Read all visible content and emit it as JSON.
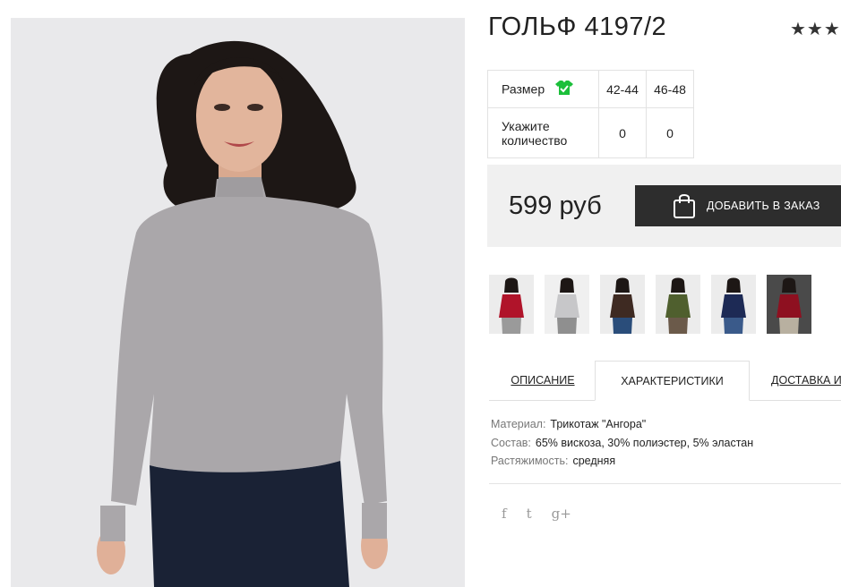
{
  "product": {
    "title": "ГОЛЬФ 4197/2",
    "rating_stars": "★★★",
    "rating": 3
  },
  "size_table": {
    "size_label": "Размер",
    "sizes": [
      "42-44",
      "46-48"
    ],
    "quantity_label": "Укажите количество",
    "quantities": [
      "0",
      "0"
    ]
  },
  "purchase": {
    "price": "599 руб",
    "add_button_label": "ДОБАВИТЬ В ЗАКАЗ"
  },
  "thumbnails": [
    {
      "top": "#b0142a",
      "bottom": "#9a9a9a",
      "bg": "#ececec"
    },
    {
      "top": "#c7c7c9",
      "bottom": "#8f8f8f",
      "bg": "#f0f0f0"
    },
    {
      "top": "#3e2a22",
      "bottom": "#2a4d7a",
      "bg": "#ececec"
    },
    {
      "top": "#4f5f2e",
      "bottom": "#6b5a4a",
      "bg": "#ececec"
    },
    {
      "top": "#1d2a55",
      "bottom": "#3a5a8a",
      "bg": "#ececec"
    },
    {
      "top": "#8e1020",
      "bottom": "#b8b0a0",
      "bg": "#4a4a4a"
    }
  ],
  "tabs": [
    {
      "label": "ОПИСАНИЕ",
      "active": false
    },
    {
      "label": "ХАРАКТЕРИСТИКИ",
      "active": true
    },
    {
      "label": "ДОСТАВКА И",
      "active": false
    }
  ],
  "specs": [
    {
      "key": "Материал:",
      "value": "Трикотаж \"Ангора\""
    },
    {
      "key": "Состав:",
      "value": "65% вискоза, 30% полиэстер, 5% эластан"
    },
    {
      "key": "Растяжимость:",
      "value": "средняя"
    }
  ],
  "social": [
    {
      "icon": "facebook-icon",
      "glyph": "f"
    },
    {
      "icon": "twitter-icon",
      "glyph": "t"
    },
    {
      "icon": "google-plus-icon",
      "glyph": "g+"
    }
  ]
}
